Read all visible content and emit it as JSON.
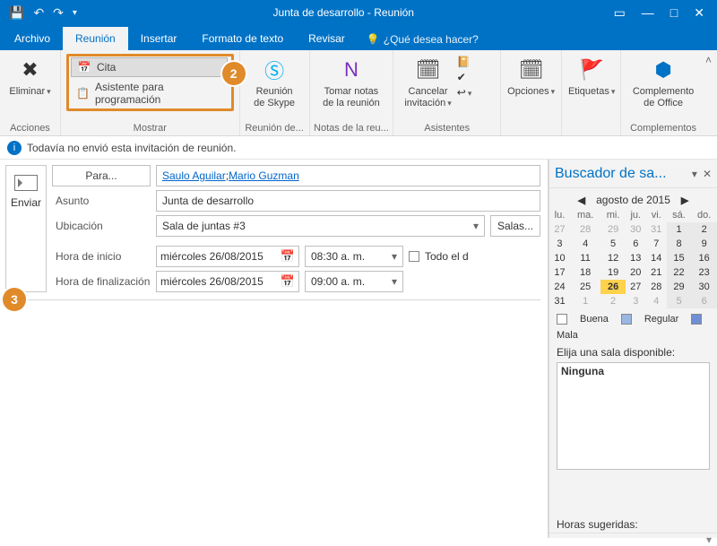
{
  "title": "Junta de desarrollo - Reunión",
  "tabs": {
    "archivo": "Archivo",
    "reunion": "Reunión",
    "insertar": "Insertar",
    "formato": "Formato de texto",
    "revisar": "Revisar",
    "tellme": "¿Qué desea hacer?"
  },
  "ribbon": {
    "acciones": {
      "label": "Acciones",
      "eliminar": "Eliminar"
    },
    "mostrar": {
      "label": "Mostrar",
      "cita": "Cita",
      "asistente": "Asistente para programación"
    },
    "skype": {
      "label": "Reunión de...",
      "btn": "Reunión\nde Skype"
    },
    "notas": {
      "label": "Notas de la reu...",
      "btn": "Tomar notas\nde la reunión"
    },
    "asist": {
      "label": "Asistentes",
      "cancelar": "Cancelar\ninvitación"
    },
    "opciones": "Opciones",
    "etiquetas": "Etiquetas",
    "comp": {
      "label": "Complementos",
      "btn": "Complemento\nde Office"
    }
  },
  "callouts": {
    "two": "2",
    "three": "3"
  },
  "infobar": "Todavía no envió esta invitación de reunión.",
  "send": "Enviar",
  "form": {
    "para_btn": "Para...",
    "para_val1": "Saulo Aguilar",
    "para_val2": "Mario Guzman",
    "asunto_lbl": "Asunto",
    "asunto_val": "Junta de desarrollo",
    "ubic_lbl": "Ubicación",
    "ubic_val": "Sala de juntas #3",
    "salas_btn": "Salas...",
    "inicio_lbl": "Hora de inicio",
    "fin_lbl": "Hora de finalización",
    "fecha": "miércoles 26/08/2015",
    "hora_inicio": "08:30 a. m.",
    "hora_fin": "09:00 a. m.",
    "todo": "Todo el d"
  },
  "finder": {
    "title": "Buscador de sa...",
    "month": "agosto de 2015",
    "dow": [
      "lu.",
      "ma.",
      "mi.",
      "ju.",
      "vi.",
      "sá.",
      "do."
    ],
    "weeks": [
      [
        {
          "d": "27",
          "o": true
        },
        {
          "d": "28",
          "o": true
        },
        {
          "d": "29",
          "o": true
        },
        {
          "d": "30",
          "o": true
        },
        {
          "d": "31",
          "o": true
        },
        {
          "d": "1",
          "a": true
        },
        {
          "d": "2",
          "a": true
        }
      ],
      [
        {
          "d": "3"
        },
        {
          "d": "4"
        },
        {
          "d": "5"
        },
        {
          "d": "6"
        },
        {
          "d": "7"
        },
        {
          "d": "8",
          "a": true
        },
        {
          "d": "9",
          "a": true
        }
      ],
      [
        {
          "d": "10"
        },
        {
          "d": "11"
        },
        {
          "d": "12"
        },
        {
          "d": "13"
        },
        {
          "d": "14"
        },
        {
          "d": "15",
          "a": true
        },
        {
          "d": "16",
          "a": true
        }
      ],
      [
        {
          "d": "17"
        },
        {
          "d": "18"
        },
        {
          "d": "19"
        },
        {
          "d": "20"
        },
        {
          "d": "21"
        },
        {
          "d": "22",
          "a": true
        },
        {
          "d": "23",
          "a": true
        }
      ],
      [
        {
          "d": "24"
        },
        {
          "d": "25"
        },
        {
          "d": "26",
          "t": true
        },
        {
          "d": "27"
        },
        {
          "d": "28"
        },
        {
          "d": "29",
          "a": true
        },
        {
          "d": "30",
          "a": true
        }
      ],
      [
        {
          "d": "31"
        },
        {
          "d": "1",
          "o": true
        },
        {
          "d": "2",
          "o": true
        },
        {
          "d": "3",
          "o": true
        },
        {
          "d": "4",
          "o": true
        },
        {
          "d": "5",
          "o": true,
          "a": true
        },
        {
          "d": "6",
          "o": true,
          "a": true
        }
      ]
    ],
    "legend": {
      "buena": "Buena",
      "regular": "Regular",
      "mala": "Mala"
    },
    "elija": "Elija una sala disponible:",
    "ninguna": "Ninguna",
    "horas": "Horas sugeridas:"
  }
}
